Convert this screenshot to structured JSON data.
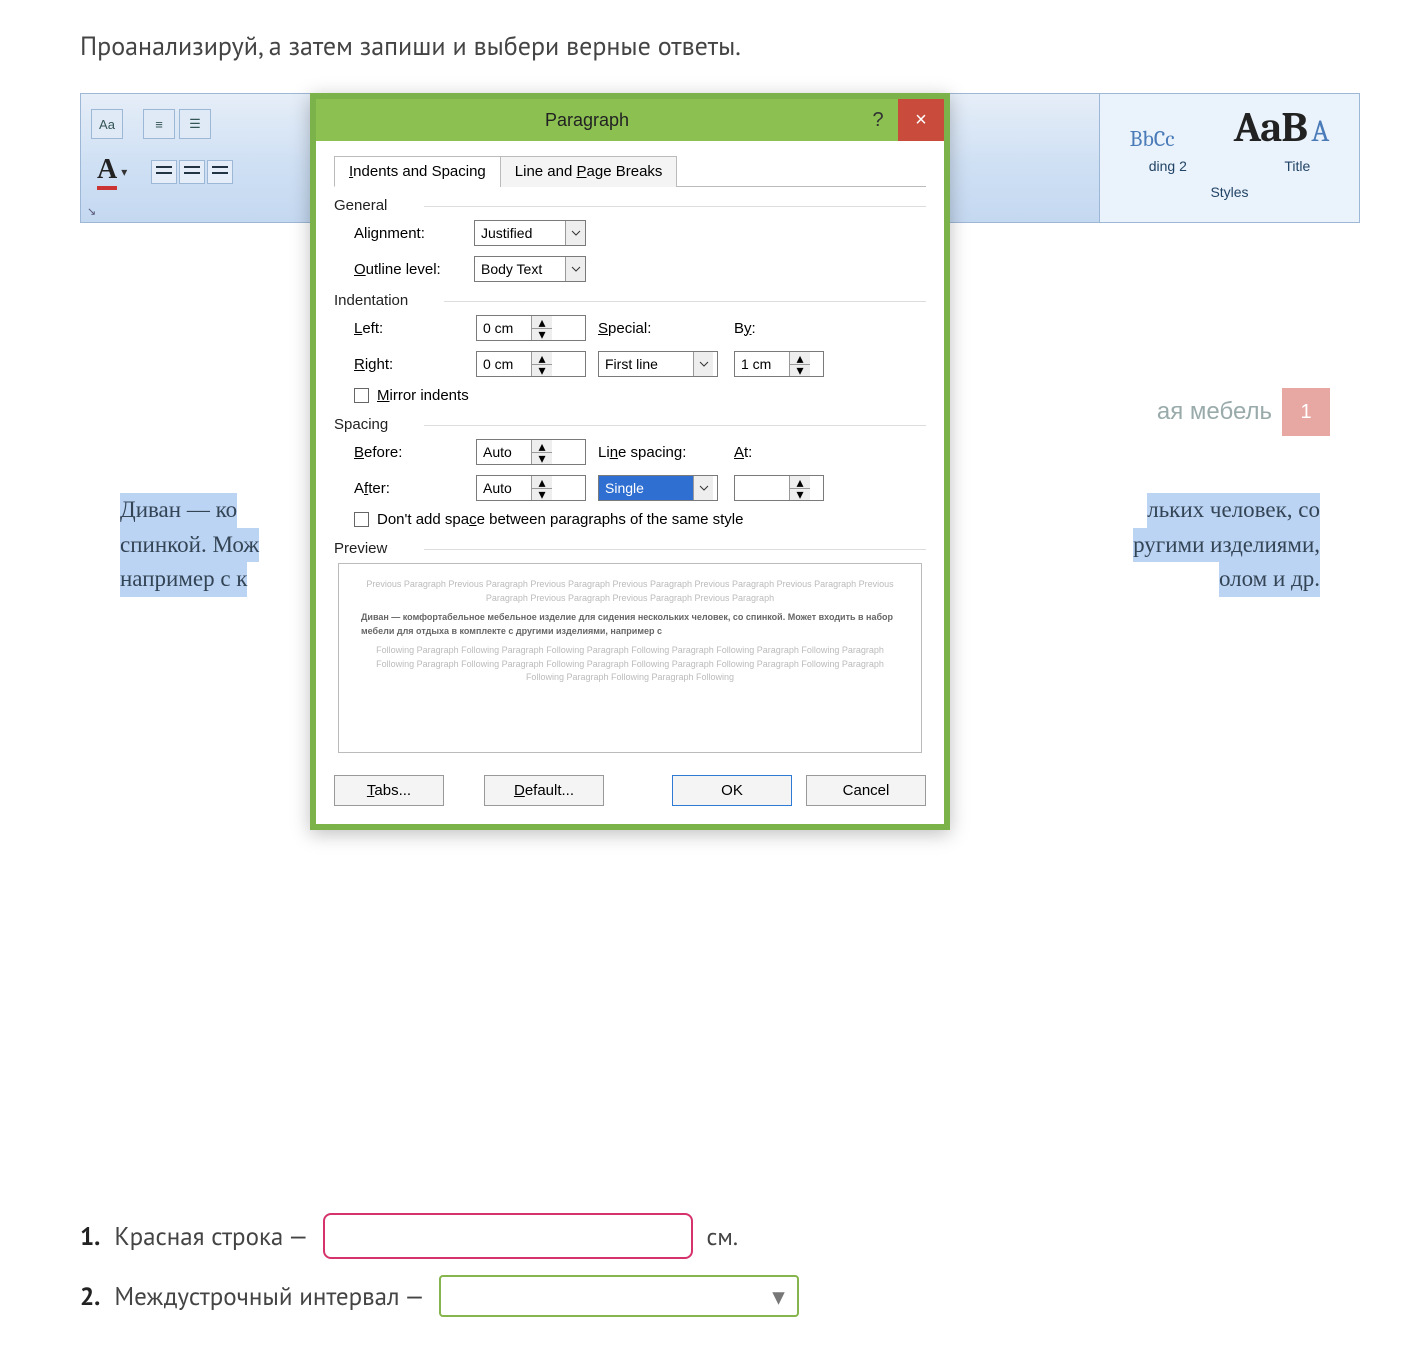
{
  "task": {
    "intro": "Проанализируй, а затем запиши и выбери верные ответы."
  },
  "word_bg": {
    "styles_sample1": "BbCc",
    "styles_sample2": "AaB",
    "styles_sample2_suffix": "A",
    "style_label1": "ding 2",
    "style_label2": "Title",
    "styles_caption": "Styles",
    "right_label_text": "ая мебель",
    "right_label_badge": "1",
    "para_left_1": "Диван — ко",
    "para_left_2": "спинкой. Мож",
    "para_left_3": "например с к",
    "para_right_1": "льких человек, со",
    "para_right_2": "ругими изделиями,",
    "para_right_3": "олом и др."
  },
  "dialog": {
    "title": "Paragraph",
    "close": "×",
    "help": "?",
    "tab1": "Indents and Spacing",
    "tab2": "Line and Page Breaks",
    "sec_general": "General",
    "alignment_label": "Alignment:",
    "alignment_value": "Justified",
    "outline_label": "Outline level:",
    "outline_value": "Body Text",
    "sec_indentation": "Indentation",
    "left_label": "Left:",
    "left_value": "0 cm",
    "right_label": "Right:",
    "right_value": "0 cm",
    "special_label": "Special:",
    "special_value": "First line",
    "by_label": "By:",
    "by_value": "1 cm",
    "mirror_label": "Mirror indents",
    "sec_spacing": "Spacing",
    "before_label": "Before:",
    "before_value": "Auto",
    "after_label": "After:",
    "after_value": "Auto",
    "linespacing_label": "Line spacing:",
    "linespacing_value": "Single",
    "at_label": "At:",
    "at_value": "",
    "dont_add_label": "Don't add space between paragraphs of the same style",
    "sec_preview": "Preview",
    "preview_prev": "Previous Paragraph Previous Paragraph Previous Paragraph Previous Paragraph Previous Paragraph Previous Paragraph Previous Paragraph Previous Paragraph Previous Paragraph Previous Paragraph",
    "preview_sample": "Диван — комфортабельное мебельное изделие для сидения нескольких человек, со спинкой. Может входить в набор мебели для отдыха в комплекте с другими изделиями, например с",
    "preview_next": "Following Paragraph Following Paragraph Following Paragraph Following Paragraph Following Paragraph Following Paragraph Following Paragraph Following Paragraph Following Paragraph Following Paragraph Following Paragraph Following Paragraph Following Paragraph Following Paragraph Following",
    "btn_tabs": "Tabs...",
    "btn_default": "Default...",
    "btn_ok": "OK",
    "btn_cancel": "Cancel"
  },
  "questions": {
    "q1_num": "1.",
    "q1_text": "Красная строка —",
    "q1_unit": "см.",
    "q2_num": "2.",
    "q2_text": "Междустрочный интервал —",
    "select_caret": "▾"
  }
}
